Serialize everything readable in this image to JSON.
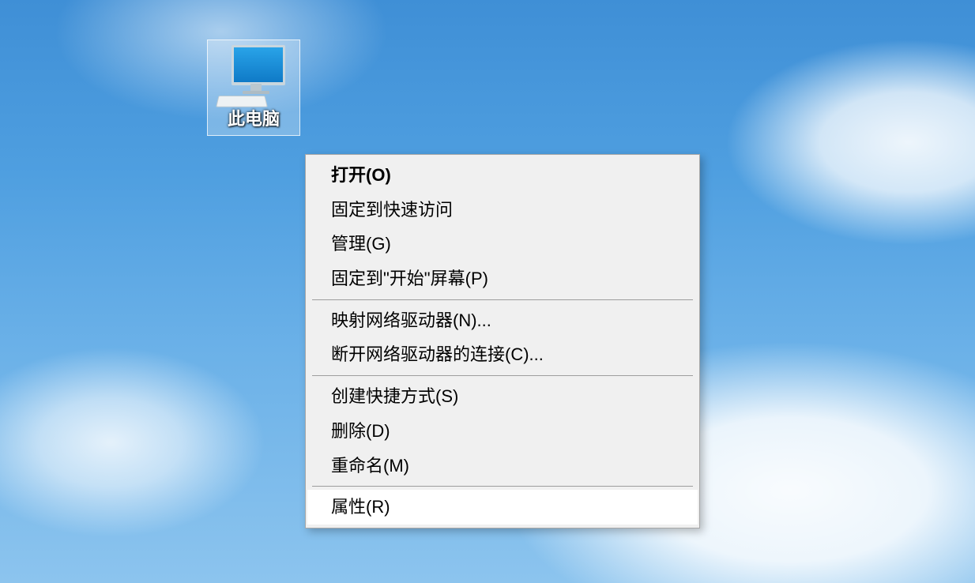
{
  "desktop_icon": {
    "label": "此电脑",
    "selected": true
  },
  "context_menu": {
    "items": [
      {
        "label": "打开(O)",
        "type": "item",
        "default": true,
        "hover": false
      },
      {
        "label": "固定到快速访问",
        "type": "item",
        "default": false,
        "hover": false
      },
      {
        "label": "管理(G)",
        "type": "item",
        "default": false,
        "hover": false
      },
      {
        "label": "固定到\"开始\"屏幕(P)",
        "type": "item",
        "default": false,
        "hover": false
      },
      {
        "type": "separator"
      },
      {
        "label": "映射网络驱动器(N)...",
        "type": "item",
        "default": false,
        "hover": false
      },
      {
        "label": "断开网络驱动器的连接(C)...",
        "type": "item",
        "default": false,
        "hover": false
      },
      {
        "type": "separator"
      },
      {
        "label": "创建快捷方式(S)",
        "type": "item",
        "default": false,
        "hover": false
      },
      {
        "label": "删除(D)",
        "type": "item",
        "default": false,
        "hover": false
      },
      {
        "label": "重命名(M)",
        "type": "item",
        "default": false,
        "hover": false
      },
      {
        "type": "separator"
      },
      {
        "label": "属性(R)",
        "type": "item",
        "default": false,
        "hover": true
      }
    ]
  }
}
